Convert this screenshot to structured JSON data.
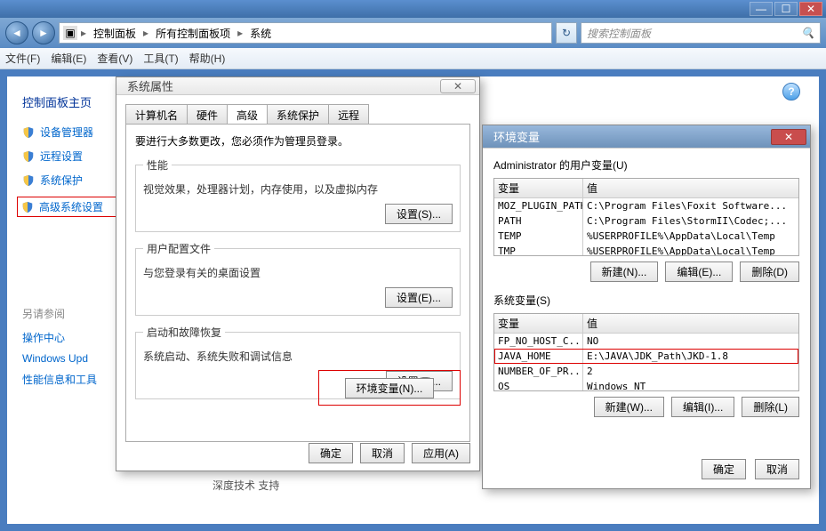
{
  "titlebar": {
    "min": "—",
    "max": "☐",
    "close": "✕"
  },
  "nav": {
    "breadcrumb": [
      "控制面板",
      "所有控制面板项",
      "系统"
    ],
    "search_placeholder": "搜索控制面板"
  },
  "menu": [
    "文件(F)",
    "编辑(E)",
    "查看(V)",
    "工具(T)",
    "帮助(H)"
  ],
  "sidebar": {
    "title": "控制面板主页",
    "items": [
      "设备管理器",
      "远程设置",
      "系统保护",
      "高级系统设置"
    ],
    "see_also_label": "另请参阅",
    "see_also": [
      "操作中心",
      "Windows Upd",
      "性能信息和工具"
    ]
  },
  "footer_text": "深度技术 支持",
  "sysprop": {
    "title": "系统属性",
    "tabs": [
      "计算机名",
      "硬件",
      "高级",
      "系统保护",
      "远程"
    ],
    "active_tab": 2,
    "req": "要进行大多数更改，您必须作为管理员登录。",
    "group_perf": {
      "label": "性能",
      "desc": "视觉效果，处理器计划，内存使用，以及虚拟内存",
      "btn": "设置(S)..."
    },
    "group_profile": {
      "label": "用户配置文件",
      "desc": "与您登录有关的桌面设置",
      "btn": "设置(E)..."
    },
    "group_startup": {
      "label": "启动和故障恢复",
      "desc": "系统启动、系统失败和调试信息",
      "btn": "设置(T)..."
    },
    "env_btn": "环境变量(N)...",
    "ok": "确定",
    "cancel": "取消",
    "apply": "应用(A)"
  },
  "envdlg": {
    "title": "环境变量",
    "user_label": "Administrator 的用户变量(U)",
    "col_var": "变量",
    "col_val": "值",
    "user_vars": [
      {
        "n": "MOZ_PLUGIN_PATH",
        "v": "C:\\Program Files\\Foxit Software..."
      },
      {
        "n": "PATH",
        "v": "C:\\Program Files\\StormII\\Codec;..."
      },
      {
        "n": "TEMP",
        "v": "%USERPROFILE%\\AppData\\Local\\Temp"
      },
      {
        "n": "TMP",
        "v": "%USERPROFILE%\\AppData\\Local\\Temp"
      }
    ],
    "sys_label": "系统变量(S)",
    "sys_vars": [
      {
        "n": "FP_NO_HOST_C...",
        "v": "NO"
      },
      {
        "n": "JAVA_HOME",
        "v": "E:\\JAVA\\JDK_Path\\JKD-1.8"
      },
      {
        "n": "NUMBER_OF_PR...",
        "v": "2"
      },
      {
        "n": "OS",
        "v": "Windows NT"
      }
    ],
    "highlight_sys_index": 1,
    "new_btn_u": "新建(N)...",
    "edit_btn_u": "编辑(E)...",
    "del_btn_u": "删除(D)",
    "new_btn_s": "新建(W)...",
    "edit_btn_s": "编辑(I)...",
    "del_btn_s": "删除(L)",
    "ok": "确定",
    "cancel": "取消"
  }
}
